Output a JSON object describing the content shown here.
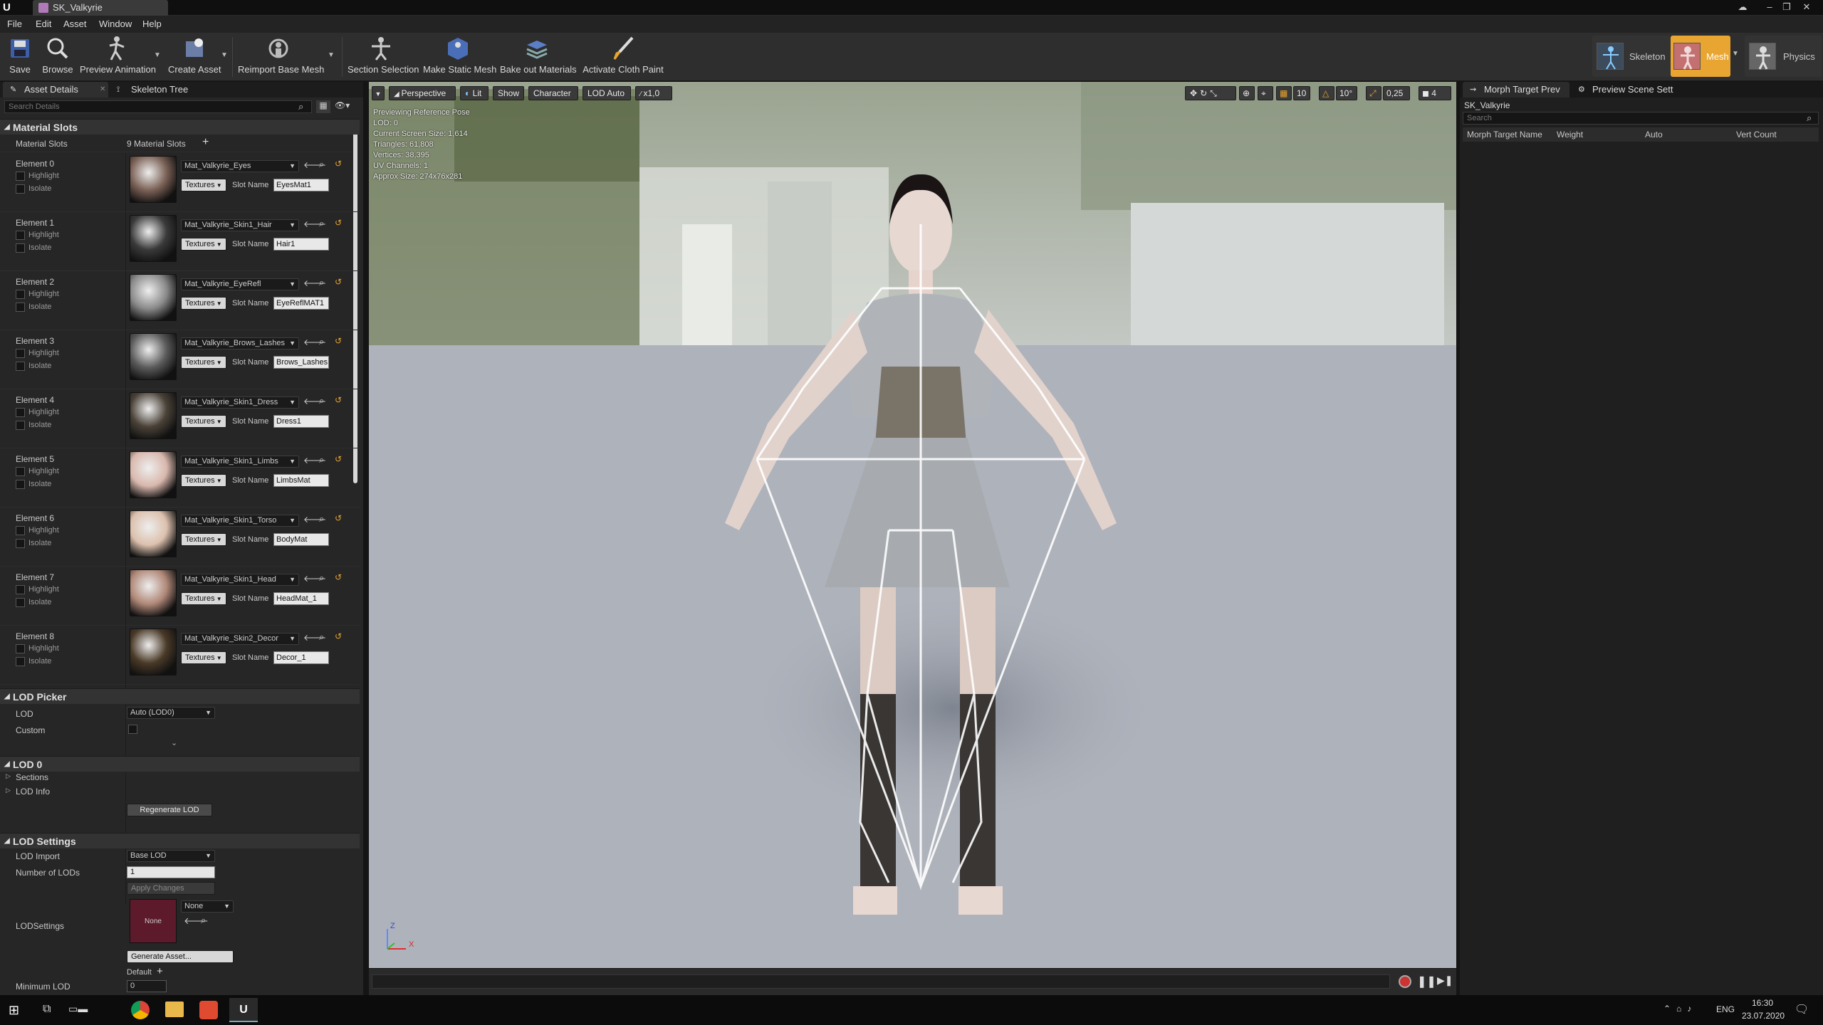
{
  "app": {
    "doc_tab": "SK_Valkyrie"
  },
  "menu": [
    "File",
    "Edit",
    "Asset",
    "Window",
    "Help"
  ],
  "toolbar": {
    "save": "Save",
    "browse": "Browse",
    "preview_animation": "Preview Animation",
    "create_asset": "Create Asset",
    "reimport": "Reimport Base Mesh",
    "section_selection": "Section Selection",
    "make_static_mesh": "Make Static Mesh",
    "bake_out": "Bake out Materials",
    "activate_cloth": "Activate Cloth Paint"
  },
  "modes": {
    "skeleton": "Skeleton",
    "mesh": "Mesh",
    "physics": "Physics"
  },
  "left_tabs": {
    "asset_details": "Asset Details",
    "skeleton_tree": "Skeleton Tree"
  },
  "search_placeholder": "Search Details",
  "material_slots": {
    "section": "Material Slots",
    "label": "Material Slots",
    "count": "9 Material Slots",
    "highlight": "Highlight",
    "isolate": "Isolate",
    "textures": "Textures",
    "slot_name_label": "Slot Name",
    "elements": [
      {
        "name": "Element 0",
        "material": "Mat_Valkyrie_Eyes",
        "slot": "EyesMat1",
        "color": "#7a6055"
      },
      {
        "name": "Element 1",
        "material": "Mat_Valkyrie_Skin1_Hair",
        "slot": "Hair1",
        "color": "#3a3a3a"
      },
      {
        "name": "Element 2",
        "material": "Mat_Valkyrie_EyeRefl",
        "slot": "EyeReflMAT1",
        "color": "#8a8a8a"
      },
      {
        "name": "Element 3",
        "material": "Mat_Valkyrie_Brows_Lashes",
        "slot": "Brows_Lashes",
        "color": "#5a5a5a"
      },
      {
        "name": "Element 4",
        "material": "Mat_Valkyrie_Skin1_Dress",
        "slot": "Dress1",
        "color": "#4a4238"
      },
      {
        "name": "Element 5",
        "material": "Mat_Valkyrie_Skin1_Limbs",
        "slot": "LimbsMat",
        "color": "#d9b8ad"
      },
      {
        "name": "Element 6",
        "material": "Mat_Valkyrie_Skin1_Torso",
        "slot": "BodyMat",
        "color": "#dcc0ad"
      },
      {
        "name": "Element 7",
        "material": "Mat_Valkyrie_Skin1_Head",
        "slot": "HeadMat_1",
        "color": "#b08878"
      },
      {
        "name": "Element 8",
        "material": "Mat_Valkyrie_Skin2_Decor",
        "slot": "Decor_1",
        "color": "#4a3a28"
      }
    ]
  },
  "lod_picker": {
    "section": "LOD Picker",
    "lod_label": "LOD",
    "lod_value": "Auto (LOD0)",
    "custom_label": "Custom"
  },
  "lod0": {
    "section": "LOD 0",
    "sections": "Sections",
    "lod_info": "LOD Info",
    "regenerate": "Regenerate LOD"
  },
  "lod_settings": {
    "section": "LOD Settings",
    "lod_import": "LOD Import",
    "lod_import_value": "Base LOD",
    "number_of_lods": "Number of LODs",
    "number_value": "1",
    "apply": "Apply Changes",
    "lodsettings": "LODSettings",
    "none_thumb": "None",
    "none_combo": "None",
    "generate": "Generate Asset...",
    "minimum_lod": "Minimum LOD",
    "default": "Default",
    "min_value": "0"
  },
  "viewport": {
    "perspective": "Perspective",
    "lit": "Lit",
    "show": "Show",
    "character": "Character",
    "lod_auto": "LOD Auto",
    "speed": "x1,0",
    "grid": "10",
    "angle": "10°",
    "scale": "0,25",
    "cam": "4",
    "stats": [
      "Previewing Reference Pose",
      "LOD: 0",
      "Current Screen Size: 1,614",
      "Triangles: 61,808",
      "Vertices: 38,395",
      "UV Channels: 1",
      "Approx Size: 274x76x281"
    ],
    "axis_z": "Z",
    "axis_x": "X"
  },
  "right_tabs": {
    "morph": "Morph Target Prev",
    "preview_scene": "Preview Scene Sett"
  },
  "morph": {
    "asset": "SK_Valkyrie",
    "search": "Search",
    "headers": [
      "Morph Target Name",
      "Weight",
      "Auto",
      "Vert Count"
    ]
  },
  "taskbar": {
    "lang": "ENG",
    "time": "16:30",
    "date": "23.07.2020"
  },
  "colors": {
    "accent_orange": "#e8a531",
    "record": "#cc3333",
    "viewport_floor": "#aeb2bb"
  }
}
